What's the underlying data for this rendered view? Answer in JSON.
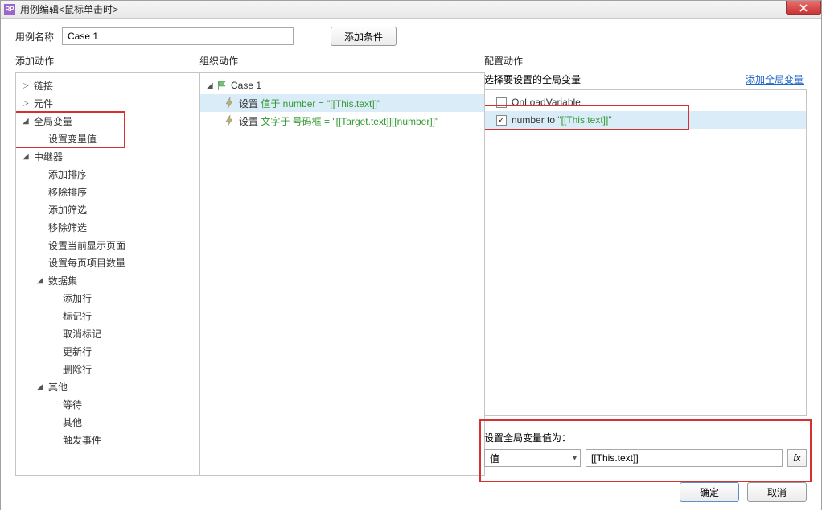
{
  "window": {
    "title": "用例编辑<鼠标单击时>"
  },
  "topbar": {
    "case_name_label": "用例名称",
    "case_name_value": "Case 1",
    "add_condition_label": "添加条件"
  },
  "columns": {
    "left_title": "添加动作",
    "mid_title": "组织动作",
    "right_title": "配置动作"
  },
  "left_tree": {
    "links": "链接",
    "widgets": "元件",
    "global_vars": "全局变量",
    "set_var_value": "设置变量值",
    "repeater": "中继器",
    "repeater_items": {
      "add_sort": "添加排序",
      "remove_sort": "移除排序",
      "add_filter": "添加筛选",
      "remove_filter": "移除筛选",
      "set_page": "设置当前显示页面",
      "set_page_items": "设置每页项目数量"
    },
    "dataset": "数据集",
    "dataset_items": {
      "add_row": "添加行",
      "mark_row": "标记行",
      "unmark": "取消标记",
      "update_row": "更新行",
      "delete_row": "删除行"
    },
    "other": "其他",
    "other_items": {
      "wait": "等待",
      "other2": "其他",
      "fire_event": "触发事件"
    }
  },
  "mid_tree": {
    "case_label": "Case 1",
    "row1_prefix": "设置 ",
    "row1_green": "值于 number = \"[[This.text]]\"",
    "row2_prefix": "设置 ",
    "row2_green": "文字于 号码框 = \"[[Target.text]][[number]]\""
  },
  "right": {
    "select_var_label": "选择要设置的全局变量",
    "add_var_link": "添加全局变量",
    "onload_var": "OnLoadVariable",
    "number_var_prefix": "number to ",
    "number_var_green": "\"[[This.text]]\"",
    "set_value_label": "设置全局变量值为：",
    "dropdown_value": "值",
    "value_input": "[[This.text]]",
    "fx_label": "fx"
  },
  "footer": {
    "ok": "确定",
    "cancel": "取消"
  }
}
